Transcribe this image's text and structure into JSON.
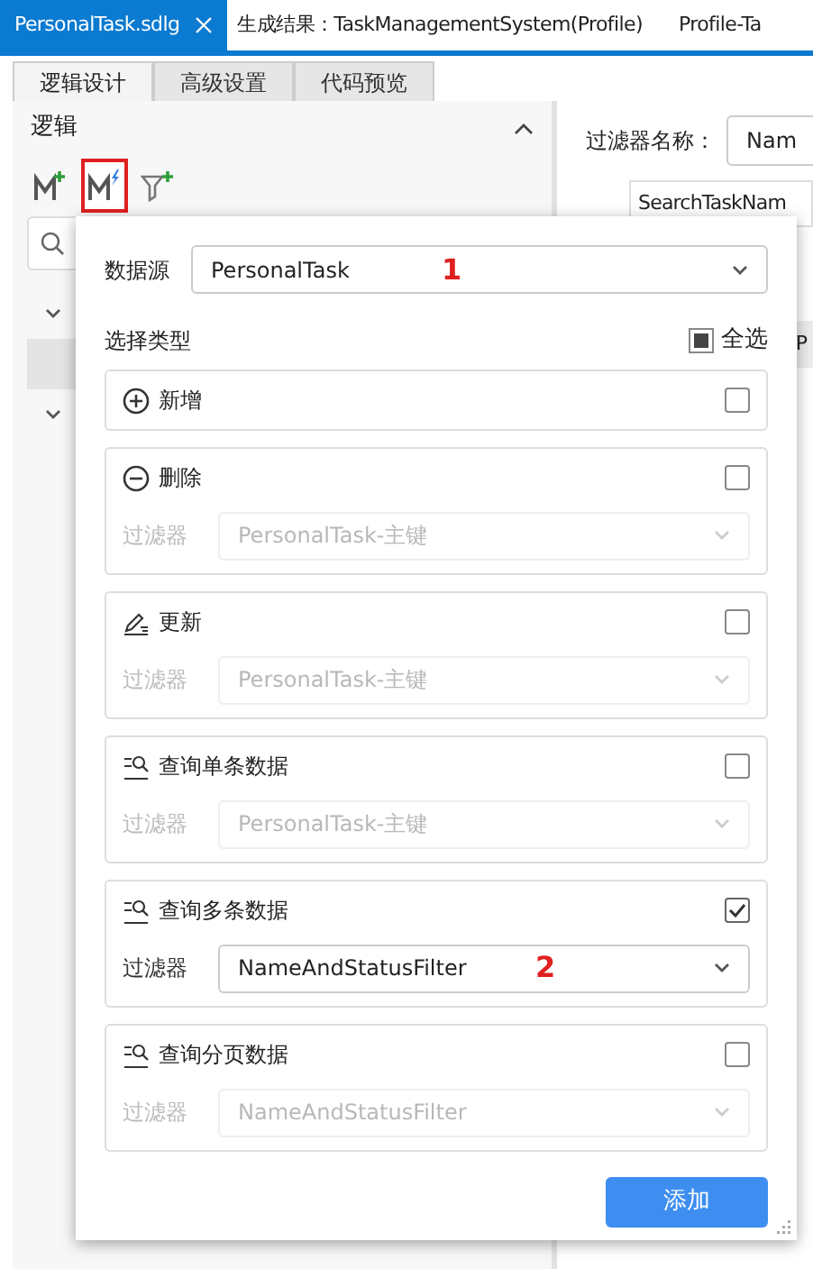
{
  "tabs": [
    {
      "label": "PersonalTask.sdlg",
      "selected": true,
      "closable": true
    },
    {
      "label": "生成结果：TaskManagementSystem(Profile)",
      "selected": false,
      "closable": false
    },
    {
      "label": "Profile-Ta",
      "selected": false,
      "closable": false
    }
  ],
  "subtabs": [
    {
      "label": "逻辑设计",
      "selected": true
    },
    {
      "label": "高级设置",
      "selected": false
    },
    {
      "label": "代码预览",
      "selected": false
    }
  ],
  "left_panel": {
    "title": "逻辑",
    "tools": [
      {
        "kind": "add-model",
        "selected": false
      },
      {
        "kind": "model-action",
        "selected": true
      },
      {
        "kind": "add-filter",
        "selected": false
      }
    ]
  },
  "right_panel": {
    "filter_name_label": "过滤器名称：",
    "filter_name_value": "Nam",
    "item": "SearchTaskNam",
    "field_value": "P"
  },
  "dialog": {
    "data_source": {
      "label": "数据源",
      "value": "PersonalTask",
      "annotation": "1"
    },
    "select_type_label": "选择类型",
    "select_all": {
      "label": "全选",
      "indeterminate": true
    },
    "operations": [
      {
        "kind": "add",
        "label": "新增",
        "checked": false
      },
      {
        "kind": "delete",
        "label": "删除",
        "checked": false,
        "filter": {
          "label": "过滤器",
          "value": "PersonalTask-主键",
          "disabled": true
        }
      },
      {
        "kind": "update",
        "label": "更新",
        "checked": false,
        "filter": {
          "label": "过滤器",
          "value": "PersonalTask-主键",
          "disabled": true
        }
      },
      {
        "kind": "query",
        "label": "查询单条数据",
        "checked": false,
        "filter": {
          "label": "过滤器",
          "value": "PersonalTask-主键",
          "disabled": true
        }
      },
      {
        "kind": "query",
        "label": "查询多条数据",
        "checked": true,
        "filter": {
          "label": "过滤器",
          "value": "NameAndStatusFilter",
          "disabled": false,
          "annotation": "2"
        }
      },
      {
        "kind": "query",
        "label": "查询分页数据",
        "checked": false,
        "filter": {
          "label": "过滤器",
          "value": "NameAndStatusFilter",
          "disabled": true
        }
      }
    ],
    "submit": "添加"
  }
}
